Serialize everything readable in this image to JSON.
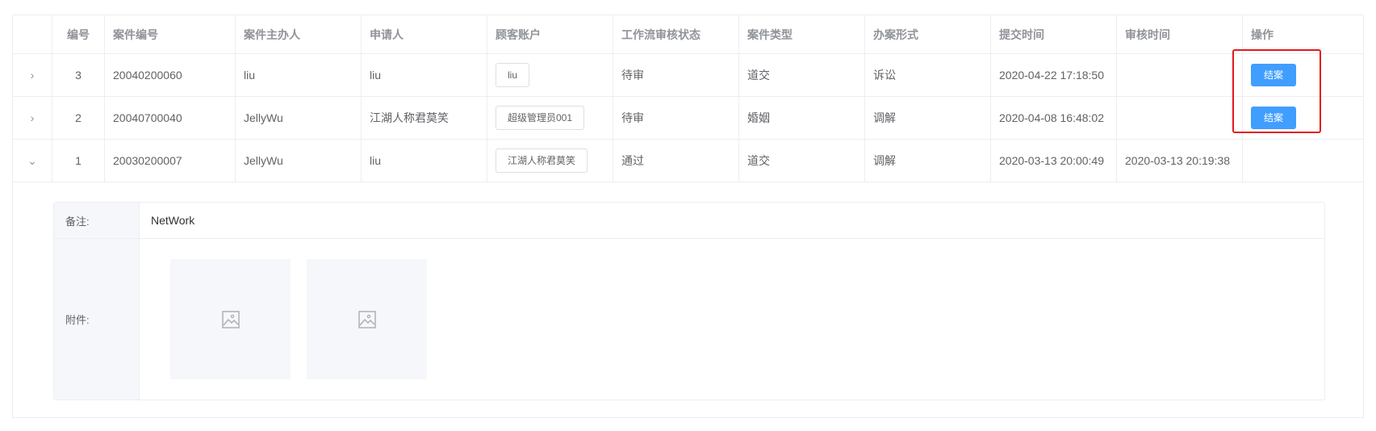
{
  "headers": [
    "",
    "编号",
    "案件编号",
    "案件主办人",
    "申请人",
    "顾客账户",
    "工作流审核状态",
    "案件类型",
    "办案形式",
    "提交时间",
    "审核时间",
    "操作"
  ],
  "rows": [
    {
      "expand": "›",
      "id": "3",
      "case_no": "20040200060",
      "handler": "liu",
      "applicant": "liu",
      "account": "liu",
      "status": "待审",
      "type": "道交",
      "form": "诉讼",
      "submit_time": "2020-04-22 17:18:50",
      "review_time": "",
      "action": "结案"
    },
    {
      "expand": "›",
      "id": "2",
      "case_no": "20040700040",
      "handler": "JellyWu",
      "applicant": "江湖人称君莫笑",
      "account": "超级管理员001",
      "status": "待审",
      "type": "婚姻",
      "form": "调解",
      "submit_time": "2020-04-08 16:48:02",
      "review_time": "",
      "action": "结案"
    },
    {
      "expand": "⌄",
      "id": "1",
      "case_no": "20030200007",
      "handler": "JellyWu",
      "applicant": "liu",
      "account": "江湖人称君莫笑",
      "status": "通过",
      "type": "道交",
      "form": "调解",
      "submit_time": "2020-03-13 20:00:49",
      "review_time": "2020-03-13 20:19:38",
      "action": ""
    }
  ],
  "detail": {
    "remark_label": "备注:",
    "remark_value": "NetWork",
    "attachment_label": "附件:"
  },
  "colors": {
    "primary": "#409eff",
    "highlight": "#e5191c",
    "border": "#ebeef5",
    "header_text": "#909399"
  }
}
